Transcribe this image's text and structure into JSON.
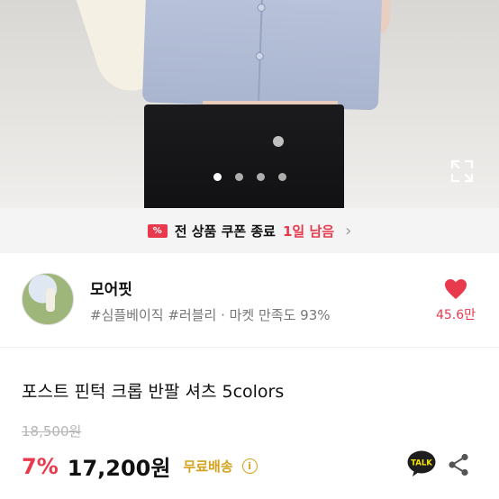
{
  "carousel": {
    "slide_count": 4,
    "active_index": 0
  },
  "coupon_banner": {
    "icon": "coupon-ticket-icon",
    "prefix": "전 상품 쿠폰 종료",
    "highlight": "1일 남음",
    "color": "#e8394d"
  },
  "shop": {
    "name": "모어핏",
    "tags": "#심플베이직 #러블리 · 마켓 만족도 93%",
    "like_count": "45.6만",
    "like_color": "#e8394d"
  },
  "product": {
    "title": "포스트 핀턱 크롭 반팔 셔츠 5colors",
    "original_price": "18,500원",
    "discount": "7%",
    "price": "17,200원",
    "shipping": "무료배송",
    "shipping_color": "#d4a21c"
  },
  "actions": {
    "kakao_label": "TALK",
    "icons": [
      "expand-icon",
      "heart-icon",
      "info-icon",
      "kakao-talk-icon",
      "share-icon"
    ]
  }
}
